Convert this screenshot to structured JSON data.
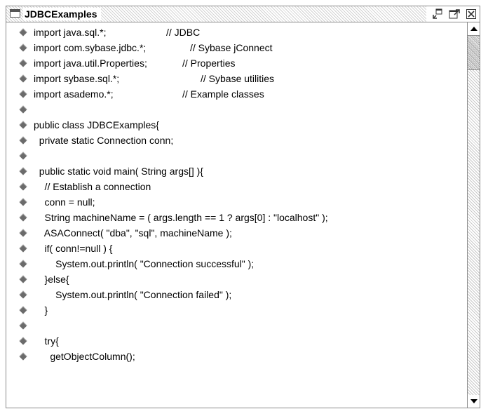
{
  "window": {
    "title": "JDBCExamples",
    "controls": {
      "restore_icon": "restore-window-icon",
      "maximize_icon": "maximize-window-icon",
      "close_icon": "close-window-icon"
    }
  },
  "code_lines": [
    {
      "code": "import java.sql.*;",
      "comment": "// JDBC"
    },
    {
      "code": "import com.sybase.jdbc.*;",
      "comment": "// Sybase jConnect"
    },
    {
      "code": "import java.util.Properties;",
      "comment": "// Properties"
    },
    {
      "code": "import sybase.sql.*;",
      "comment": "// Sybase utilities"
    },
    {
      "code": "import asademo.*;",
      "comment": "// Example classes"
    },
    {
      "code": "",
      "comment": ""
    },
    {
      "code": "public class JDBCExamples{",
      "comment": ""
    },
    {
      "code": "  private static Connection conn;",
      "comment": ""
    },
    {
      "code": "",
      "comment": ""
    },
    {
      "code": "  public static void main( String args[] ){",
      "comment": ""
    },
    {
      "code": "    // Establish a connection",
      "comment": ""
    },
    {
      "code": "    conn = null;",
      "comment": ""
    },
    {
      "code": "    String machineName = ( args.length == 1 ? args[0] : \"localhost\" );",
      "comment": ""
    },
    {
      "code": "    ASAConnect( \"dba\", \"sql\", machineName );",
      "comment": ""
    },
    {
      "code": "    if( conn!=null ) {",
      "comment": ""
    },
    {
      "code": "        System.out.println( \"Connection successful\" );",
      "comment": ""
    },
    {
      "code": "    }else{",
      "comment": ""
    },
    {
      "code": "        System.out.println( \"Connection failed\" );",
      "comment": ""
    },
    {
      "code": "    }",
      "comment": ""
    },
    {
      "code": "",
      "comment": ""
    },
    {
      "code": "    try{",
      "comment": ""
    },
    {
      "code": "      getObjectColumn();",
      "comment": ""
    }
  ],
  "colors": {
    "bullet": "#6b6b6b",
    "border": "#8a8a8a",
    "text": "#000000"
  }
}
